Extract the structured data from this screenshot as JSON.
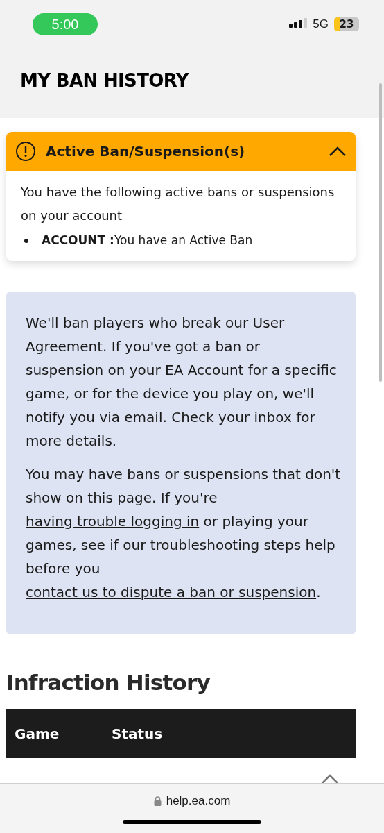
{
  "status_bar": {
    "time": "5:00",
    "network": "5G",
    "battery": "23"
  },
  "page_title": "MY BAN HISTORY",
  "alert": {
    "title": "Active Ban/Suspension(s)",
    "expanded": true,
    "body": "You have the following active bans or suspensions on your account",
    "items": [
      {
        "label": "ACCOUNT :",
        "text": "You have an Active Ban"
      }
    ]
  },
  "info": {
    "paragraphs": [
      [
        {
          "kind": "text",
          "text": "We'll ban players who break our User Agreement. If you've got a ban or suspension on your EA Account for a specific game, or for the device you play on, we'll notify you via email. Check your inbox for more details."
        }
      ],
      [
        {
          "kind": "text",
          "text": "You may have bans or suspensions that don't show on this page. If you're "
        },
        {
          "kind": "link",
          "text": "having trouble logging in"
        },
        {
          "kind": "text",
          "text": " or playing your games, see if our troubleshooting steps help before you "
        },
        {
          "kind": "link",
          "text": "contact us to dispute a ban or suspension"
        },
        {
          "kind": "text",
          "text": "."
        }
      ]
    ]
  },
  "infraction": {
    "heading": "Infraction History",
    "columns": [
      "Game",
      "Status"
    ],
    "rows": [
      {
        "expanded": true
      }
    ]
  },
  "url_bar": {
    "address": "help.ea.com"
  }
}
